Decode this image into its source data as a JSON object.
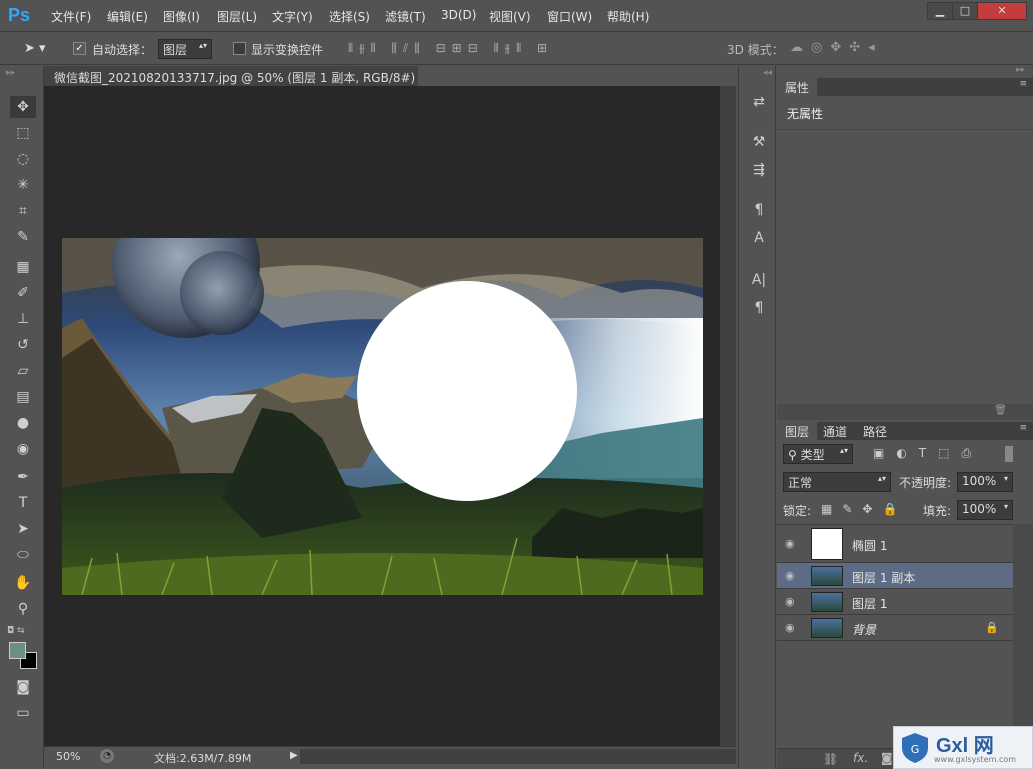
{
  "app": {
    "logo": "Ps"
  },
  "menu": [
    "文件(F)",
    "编辑(E)",
    "图像(I)",
    "图层(L)",
    "文字(Y)",
    "选择(S)",
    "滤镜(T)",
    "3D(D)",
    "视图(V)",
    "窗口(W)",
    "帮助(H)"
  ],
  "window_controls": {
    "minimize": "▁",
    "maximize": "□",
    "close": "✕"
  },
  "options": {
    "auto_select_label": "自动选择：",
    "auto_select_checked": true,
    "auto_select_value": "图层",
    "show_transform_label": "显示变换控件",
    "mode_3d_label": "3D 模式："
  },
  "document": {
    "tab_title": "微信截图_20210820133717.jpg @ 50% (图层 1 副本, RGB/8#) *",
    "zoom": "50%",
    "doc_size": "文档:2.63M/7.89M"
  },
  "properties": {
    "tab": "属性",
    "empty_text": "无属性"
  },
  "layers": {
    "tabs": [
      "图层",
      "通道",
      "路径"
    ],
    "filter_kind": "类型",
    "blend_mode": "正常",
    "opacity_label": "不透明度:",
    "opacity_value": "100%",
    "lock_label": "锁定:",
    "fill_label": "填充:",
    "fill_value": "100%",
    "items": [
      {
        "name": "椭圆 1",
        "selected": false,
        "locked": false
      },
      {
        "name": "图层 1 副本",
        "selected": true,
        "locked": false
      },
      {
        "name": "图层 1",
        "selected": false,
        "locked": false
      },
      {
        "name": "背景",
        "selected": false,
        "locked": true
      }
    ],
    "footer_icons": [
      "link-icon",
      "fx-icon",
      "mask-icon"
    ]
  },
  "watermark": {
    "text": "Gxl 网",
    "url": "www.gxlsystem.com"
  },
  "colors": {
    "foreground": "#6b8f80",
    "background": "#000000",
    "ps_blue": "#31a8ff",
    "selection": "#5d6c84"
  }
}
